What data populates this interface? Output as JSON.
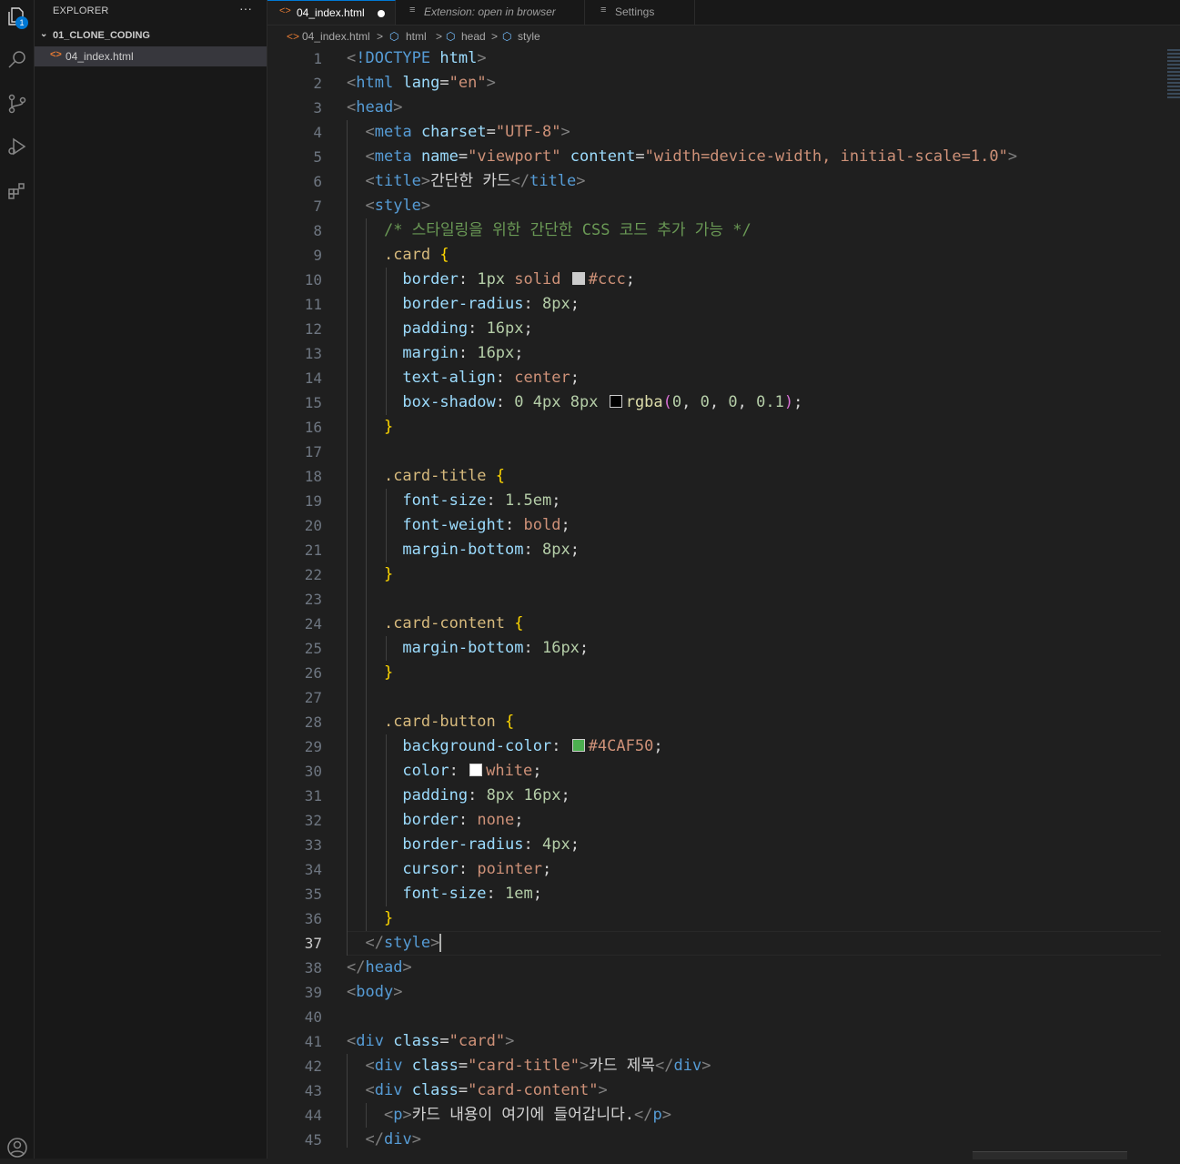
{
  "activity_bar": {
    "explorer_badge": "1",
    "items": [
      "files-icon",
      "search-icon",
      "source-control-icon",
      "run-debug-icon",
      "extensions-icon"
    ]
  },
  "sidebar": {
    "title": "EXPLORER",
    "more": "···",
    "folder_chevron": "⌄",
    "folder": "01_CLONE_CODING",
    "file_icon": "<>",
    "file": "04_index.html"
  },
  "tabs": [
    {
      "icon": "<>",
      "label": "04_index.html",
      "active": true,
      "dirty": true
    },
    {
      "icon": "≡",
      "label": "Extension: open in browser",
      "active": false
    },
    {
      "icon": "≡",
      "label": "Settings",
      "active": false
    }
  ],
  "breadcrumb": {
    "file_icon": "<>",
    "file": "04_index.html",
    "sep": ">",
    "items": [
      "html",
      "head",
      "style"
    ],
    "symbol_icon": "⬡"
  },
  "editor": {
    "current_line": 37,
    "lines": [
      [
        [
          "t-pun",
          "<"
        ],
        [
          "t-dt",
          "!DOCTYPE"
        ],
        [
          "t-txt",
          " "
        ],
        [
          "t-attr",
          "html"
        ],
        [
          "t-pun",
          ">"
        ]
      ],
      [
        [
          "t-pun",
          "<"
        ],
        [
          "t-tag",
          "html"
        ],
        [
          "t-txt",
          " "
        ],
        [
          "t-attr",
          "lang"
        ],
        [
          "t-txt",
          "="
        ],
        [
          "t-str",
          "\"en\""
        ],
        [
          "t-pun",
          ">"
        ]
      ],
      [
        [
          "t-pun",
          "<"
        ],
        [
          "t-tag",
          "head"
        ],
        [
          "t-pun",
          ">"
        ]
      ],
      [
        [
          "t-txt",
          "  "
        ],
        [
          "t-pun",
          "<"
        ],
        [
          "t-tag",
          "meta"
        ],
        [
          "t-txt",
          " "
        ],
        [
          "t-attr",
          "charset"
        ],
        [
          "t-txt",
          "="
        ],
        [
          "t-str",
          "\"UTF-8\""
        ],
        [
          "t-pun",
          ">"
        ]
      ],
      [
        [
          "t-txt",
          "  "
        ],
        [
          "t-pun",
          "<"
        ],
        [
          "t-tag",
          "meta"
        ],
        [
          "t-txt",
          " "
        ],
        [
          "t-attr",
          "name"
        ],
        [
          "t-txt",
          "="
        ],
        [
          "t-str",
          "\"viewport\""
        ],
        [
          "t-txt",
          " "
        ],
        [
          "t-attr",
          "content"
        ],
        [
          "t-txt",
          "="
        ],
        [
          "t-str",
          "\"width=device-width, initial-scale=1.0\""
        ],
        [
          "t-pun",
          ">"
        ]
      ],
      [
        [
          "t-txt",
          "  "
        ],
        [
          "t-pun",
          "<"
        ],
        [
          "t-tag",
          "title"
        ],
        [
          "t-pun",
          ">"
        ],
        [
          "t-txt",
          "간단한 카드"
        ],
        [
          "t-pun",
          "</"
        ],
        [
          "t-tag",
          "title"
        ],
        [
          "t-pun",
          ">"
        ]
      ],
      [
        [
          "t-txt",
          "  "
        ],
        [
          "t-pun",
          "<"
        ],
        [
          "t-tag",
          "style"
        ],
        [
          "t-pun",
          ">"
        ]
      ],
      [
        [
          "t-txt",
          "    "
        ],
        [
          "t-com",
          "/* 스타일링을 위한 간단한 CSS 코드 추가 가능 */"
        ]
      ],
      [
        [
          "t-txt",
          "    "
        ],
        [
          "t-sel",
          ".card"
        ],
        [
          "t-txt",
          " "
        ],
        [
          "t-br",
          "{"
        ]
      ],
      [
        [
          "t-txt",
          "      "
        ],
        [
          "t-prop",
          "border"
        ],
        [
          "t-txt",
          ": "
        ],
        [
          "t-num",
          "1px"
        ],
        [
          "t-txt",
          " "
        ],
        [
          "t-val",
          "solid"
        ],
        [
          "t-txt",
          " "
        ],
        [
          "swatch",
          "#cccccc"
        ],
        [
          "t-val",
          "#ccc"
        ],
        [
          "t-txt",
          ";"
        ]
      ],
      [
        [
          "t-txt",
          "      "
        ],
        [
          "t-prop",
          "border-radius"
        ],
        [
          "t-txt",
          ": "
        ],
        [
          "t-num",
          "8px"
        ],
        [
          "t-txt",
          ";"
        ]
      ],
      [
        [
          "t-txt",
          "      "
        ],
        [
          "t-prop",
          "padding"
        ],
        [
          "t-txt",
          ": "
        ],
        [
          "t-num",
          "16px"
        ],
        [
          "t-txt",
          ";"
        ]
      ],
      [
        [
          "t-txt",
          "      "
        ],
        [
          "t-prop",
          "margin"
        ],
        [
          "t-txt",
          ": "
        ],
        [
          "t-num",
          "16px"
        ],
        [
          "t-txt",
          ";"
        ]
      ],
      [
        [
          "t-txt",
          "      "
        ],
        [
          "t-prop",
          "text-align"
        ],
        [
          "t-txt",
          ": "
        ],
        [
          "t-val",
          "center"
        ],
        [
          "t-txt",
          ";"
        ]
      ],
      [
        [
          "t-txt",
          "      "
        ],
        [
          "t-prop",
          "box-shadow"
        ],
        [
          "t-txt",
          ": "
        ],
        [
          "t-num",
          "0"
        ],
        [
          "t-txt",
          " "
        ],
        [
          "t-num",
          "4px"
        ],
        [
          "t-txt",
          " "
        ],
        [
          "t-num",
          "8px"
        ],
        [
          "t-txt",
          " "
        ],
        [
          "swatch",
          "#000000"
        ],
        [
          "t-fn",
          "rgba"
        ],
        [
          "t-br2",
          "("
        ],
        [
          "t-num",
          "0"
        ],
        [
          "t-txt",
          ", "
        ],
        [
          "t-num",
          "0"
        ],
        [
          "t-txt",
          ", "
        ],
        [
          "t-num",
          "0"
        ],
        [
          "t-txt",
          ", "
        ],
        [
          "t-num",
          "0.1"
        ],
        [
          "t-br2",
          ")"
        ],
        [
          "t-txt",
          ";"
        ]
      ],
      [
        [
          "t-txt",
          "    "
        ],
        [
          "t-br",
          "}"
        ]
      ],
      [],
      [
        [
          "t-txt",
          "    "
        ],
        [
          "t-sel",
          ".card-title"
        ],
        [
          "t-txt",
          " "
        ],
        [
          "t-br",
          "{"
        ]
      ],
      [
        [
          "t-txt",
          "      "
        ],
        [
          "t-prop",
          "font-size"
        ],
        [
          "t-txt",
          ": "
        ],
        [
          "t-num",
          "1.5em"
        ],
        [
          "t-txt",
          ";"
        ]
      ],
      [
        [
          "t-txt",
          "      "
        ],
        [
          "t-prop",
          "font-weight"
        ],
        [
          "t-txt",
          ": "
        ],
        [
          "t-val",
          "bold"
        ],
        [
          "t-txt",
          ";"
        ]
      ],
      [
        [
          "t-txt",
          "      "
        ],
        [
          "t-prop",
          "margin-bottom"
        ],
        [
          "t-txt",
          ": "
        ],
        [
          "t-num",
          "8px"
        ],
        [
          "t-txt",
          ";"
        ]
      ],
      [
        [
          "t-txt",
          "    "
        ],
        [
          "t-br",
          "}"
        ]
      ],
      [],
      [
        [
          "t-txt",
          "    "
        ],
        [
          "t-sel",
          ".card-content"
        ],
        [
          "t-txt",
          " "
        ],
        [
          "t-br",
          "{"
        ]
      ],
      [
        [
          "t-txt",
          "      "
        ],
        [
          "t-prop",
          "margin-bottom"
        ],
        [
          "t-txt",
          ": "
        ],
        [
          "t-num",
          "16px"
        ],
        [
          "t-txt",
          ";"
        ]
      ],
      [
        [
          "t-txt",
          "    "
        ],
        [
          "t-br",
          "}"
        ]
      ],
      [],
      [
        [
          "t-txt",
          "    "
        ],
        [
          "t-sel",
          ".card-button"
        ],
        [
          "t-txt",
          " "
        ],
        [
          "t-br",
          "{"
        ]
      ],
      [
        [
          "t-txt",
          "      "
        ],
        [
          "t-prop",
          "background-color"
        ],
        [
          "t-txt",
          ": "
        ],
        [
          "swatch",
          "#4CAF50"
        ],
        [
          "t-val",
          "#4CAF50"
        ],
        [
          "t-txt",
          ";"
        ]
      ],
      [
        [
          "t-txt",
          "      "
        ],
        [
          "t-prop",
          "color"
        ],
        [
          "t-txt",
          ": "
        ],
        [
          "swatch",
          "#ffffff"
        ],
        [
          "t-val",
          "white"
        ],
        [
          "t-txt",
          ";"
        ]
      ],
      [
        [
          "t-txt",
          "      "
        ],
        [
          "t-prop",
          "padding"
        ],
        [
          "t-txt",
          ": "
        ],
        [
          "t-num",
          "8px"
        ],
        [
          "t-txt",
          " "
        ],
        [
          "t-num",
          "16px"
        ],
        [
          "t-txt",
          ";"
        ]
      ],
      [
        [
          "t-txt",
          "      "
        ],
        [
          "t-prop",
          "border"
        ],
        [
          "t-txt",
          ": "
        ],
        [
          "t-val",
          "none"
        ],
        [
          "t-txt",
          ";"
        ]
      ],
      [
        [
          "t-txt",
          "      "
        ],
        [
          "t-prop",
          "border-radius"
        ],
        [
          "t-txt",
          ": "
        ],
        [
          "t-num",
          "4px"
        ],
        [
          "t-txt",
          ";"
        ]
      ],
      [
        [
          "t-txt",
          "      "
        ],
        [
          "t-prop",
          "cursor"
        ],
        [
          "t-txt",
          ": "
        ],
        [
          "t-val",
          "pointer"
        ],
        [
          "t-txt",
          ";"
        ]
      ],
      [
        [
          "t-txt",
          "      "
        ],
        [
          "t-prop",
          "font-size"
        ],
        [
          "t-txt",
          ": "
        ],
        [
          "t-num",
          "1em"
        ],
        [
          "t-txt",
          ";"
        ]
      ],
      [
        [
          "t-txt",
          "    "
        ],
        [
          "t-br",
          "}"
        ]
      ],
      [
        [
          "t-txt",
          "  "
        ],
        [
          "t-pun",
          "</"
        ],
        [
          "t-tag",
          "style"
        ],
        [
          "t-pun",
          ">"
        ],
        [
          "caret",
          ""
        ]
      ],
      [
        [
          "t-pun",
          "</"
        ],
        [
          "t-tag",
          "head"
        ],
        [
          "t-pun",
          ">"
        ]
      ],
      [
        [
          "t-pun",
          "<"
        ],
        [
          "t-tag",
          "body"
        ],
        [
          "t-pun",
          ">"
        ]
      ],
      [],
      [
        [
          "t-pun",
          "<"
        ],
        [
          "t-tag",
          "div"
        ],
        [
          "t-txt",
          " "
        ],
        [
          "t-attr",
          "class"
        ],
        [
          "t-txt",
          "="
        ],
        [
          "t-str",
          "\"card\""
        ],
        [
          "t-pun",
          ">"
        ]
      ],
      [
        [
          "t-txt",
          "  "
        ],
        [
          "t-pun",
          "<"
        ],
        [
          "t-tag",
          "div"
        ],
        [
          "t-txt",
          " "
        ],
        [
          "t-attr",
          "class"
        ],
        [
          "t-txt",
          "="
        ],
        [
          "t-str",
          "\"card-title\""
        ],
        [
          "t-pun",
          ">"
        ],
        [
          "t-txt",
          "카드 제목"
        ],
        [
          "t-pun",
          "</"
        ],
        [
          "t-tag",
          "div"
        ],
        [
          "t-pun",
          ">"
        ]
      ],
      [
        [
          "t-txt",
          "  "
        ],
        [
          "t-pun",
          "<"
        ],
        [
          "t-tag",
          "div"
        ],
        [
          "t-txt",
          " "
        ],
        [
          "t-attr",
          "class"
        ],
        [
          "t-txt",
          "="
        ],
        [
          "t-str",
          "\"card-content\""
        ],
        [
          "t-pun",
          ">"
        ]
      ],
      [
        [
          "t-txt",
          "    "
        ],
        [
          "t-pun",
          "<"
        ],
        [
          "t-tag",
          "p"
        ],
        [
          "t-pun",
          ">"
        ],
        [
          "t-txt",
          "카드 내용이 여기에 들어갑니다."
        ],
        [
          "t-pun",
          "</"
        ],
        [
          "t-tag",
          "p"
        ],
        [
          "t-pun",
          ">"
        ]
      ],
      [
        [
          "t-txt",
          "  "
        ],
        [
          "t-pun",
          "</"
        ],
        [
          "t-tag",
          "div"
        ],
        [
          "t-pun",
          ">"
        ]
      ]
    ]
  }
}
